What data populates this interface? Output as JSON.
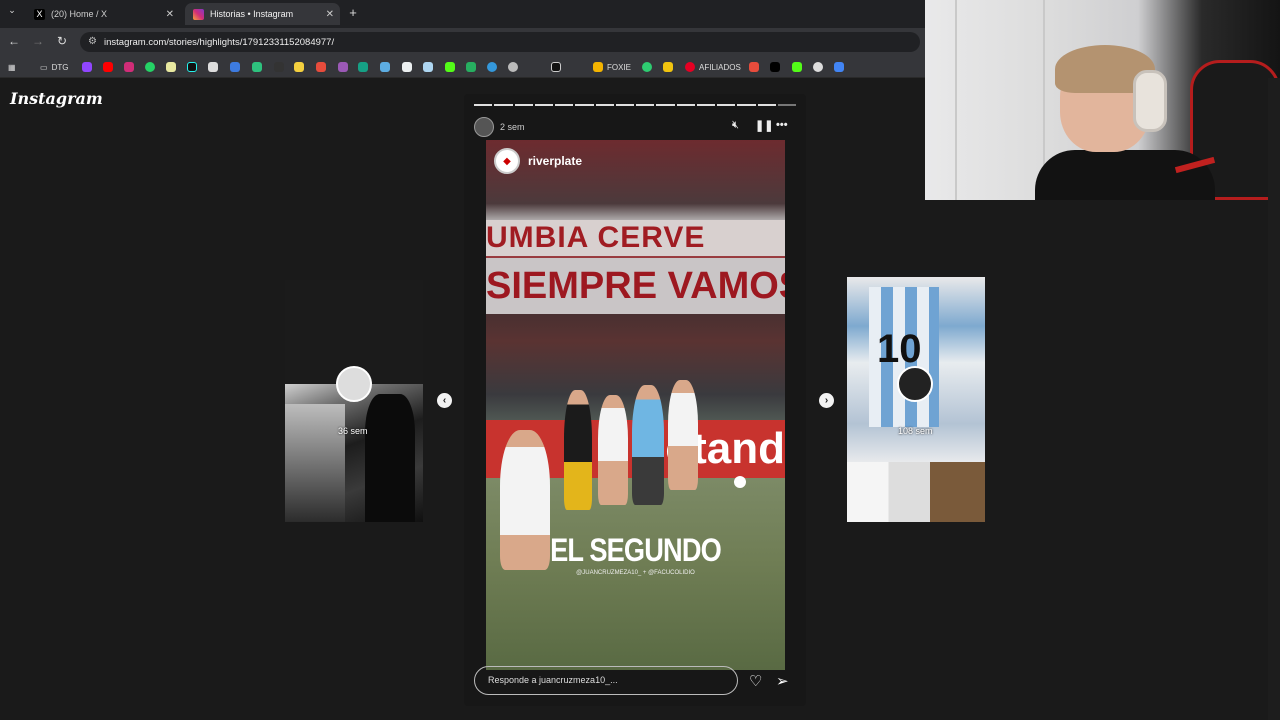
{
  "browser": {
    "tabs": [
      {
        "label": "(20) Home / X"
      },
      {
        "label": "Historias • Instagram"
      }
    ],
    "url": "instagram.com/stories/highlights/17912331152084977/",
    "bookmarks": [
      {
        "label": "DTG"
      },
      {
        "label": "FOXIE"
      },
      {
        "label": "AFILIADOS"
      }
    ]
  },
  "instagram": {
    "logo": "Instagram"
  },
  "story": {
    "time": "2 sem",
    "username": "riverplate",
    "headline": "EL SEGUNDO",
    "credits": "@JUANCRUZMEZA10_ + @FACUCOLIDIO",
    "banner_top": "UMBIA CERVE",
    "banner_mid": "SIEMPRE VAMOS A ES",
    "ad_board": "ootand",
    "reply_placeholder": "Responde a juancruzmeza10_..."
  },
  "side_stories": {
    "left_time": "36 sem",
    "right_time": "108 sem"
  },
  "icons": {
    "mute": "mute-icon",
    "pause": "pause-icon",
    "more": "more-icon",
    "heart": "heart-icon",
    "send": "send-icon"
  }
}
